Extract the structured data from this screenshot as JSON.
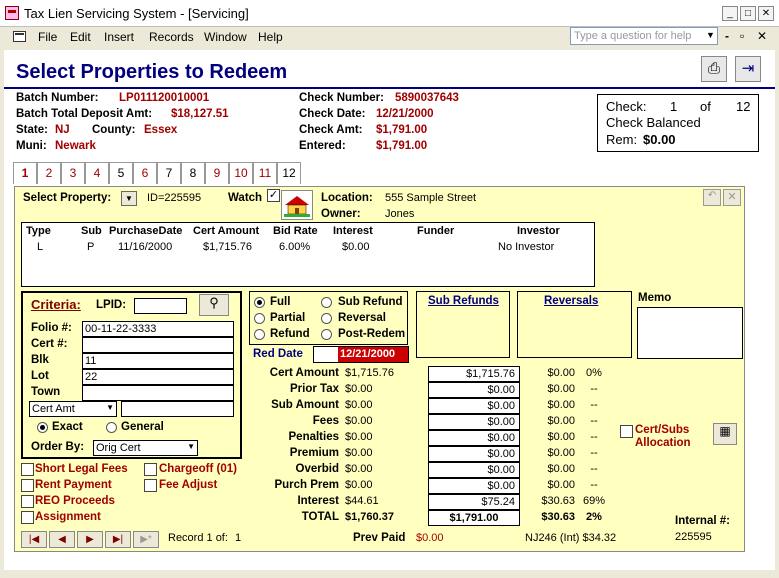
{
  "window": {
    "title": "Tax Lien Servicing System - [Servicing]",
    "minimize": "_",
    "maximize": "□",
    "close": "✕"
  },
  "menu": {
    "items": [
      "File",
      "Edit",
      "Insert",
      "Records",
      "Window",
      "Help"
    ],
    "ask_placeholder": "Type a question for help"
  },
  "heading": "Select Properties to Redeem",
  "header": {
    "batch_number_label": "Batch Number:",
    "batch_number": "LP011120010001",
    "batch_total_label": "Batch Total Deposit Amt:",
    "batch_total": "$18,127.51",
    "state_label": "State:",
    "state": "NJ",
    "county_label": "County:",
    "county": "Essex",
    "muni_label": "Muni:",
    "muni": "Newark",
    "check_number_label": "Check Number:",
    "check_number": "5890037643",
    "check_date_label": "Check Date:",
    "check_date": "12/21/2000",
    "check_amt_label": "Check Amt:",
    "check_amt": "$1,791.00",
    "entered_label": "Entered:",
    "entered": "$1,791.00"
  },
  "check_box": {
    "line1_label": "Check:",
    "current": "1",
    "of": "of",
    "total": "12",
    "balanced": "Check Balanced",
    "rem_label": "Rem:",
    "rem": "$0.00"
  },
  "tabs": [
    "1",
    "2",
    "3",
    "4",
    "5",
    "6",
    "7",
    "8",
    "9",
    "10",
    "11",
    "12"
  ],
  "property": {
    "select_label": "Select Property:",
    "id": "ID=225595",
    "watch_label": "Watch",
    "location_label": "Location:",
    "location": "555 Sample Street",
    "owner_label": "Owner:",
    "owner": "Jones"
  },
  "lien_table": {
    "headers": [
      "Type",
      "Sub",
      "PurchaseDate",
      "Cert Amount",
      "Bid Rate",
      "Interest",
      "Funder",
      "Investor"
    ],
    "row": [
      "L",
      "P",
      "11/16/2000",
      "$1,715.76",
      "6.00%",
      "$0.00",
      "",
      "No Investor"
    ]
  },
  "criteria": {
    "title": "Criteria:",
    "lpid_label": "LPID:",
    "lpid": "",
    "folio_label": "Folio #:",
    "folio": "00-11-22-3333",
    "cert_label": "Cert #:",
    "cert": "",
    "blk_label": "Blk",
    "blk": "11",
    "lot_label": "Lot",
    "lot": "22",
    "town_label": "Town",
    "town": "",
    "amount_type": "Cert Amt",
    "amount_value": "",
    "exact": "Exact",
    "general": "General",
    "order_by_label": "Order By:",
    "order_by": "Orig Cert"
  },
  "redeem_options": {
    "full": "Full",
    "partial": "Partial",
    "refund": "Refund",
    "sub_refund": "Sub Refund",
    "reversal": "Reversal",
    "post_redem": "Post-Redem"
  },
  "links": {
    "sub_refunds": "Sub Refunds",
    "reversals": "Reversals",
    "memo": "Memo"
  },
  "red_date": {
    "label": "Red Date",
    "value": "12/21/2000"
  },
  "amounts": [
    {
      "label": "Cert Amount",
      "orig": "$1,715.76",
      "amt": "$1,715.76",
      "sub": "$0.00",
      "pct": "0%"
    },
    {
      "label": "Prior Tax",
      "orig": "$0.00",
      "amt": "$0.00",
      "sub": "$0.00",
      "pct": "--"
    },
    {
      "label": "Sub Amount",
      "orig": "$0.00",
      "amt": "$0.00",
      "sub": "$0.00",
      "pct": "--"
    },
    {
      "label": "Fees",
      "orig": "$0.00",
      "amt": "$0.00",
      "sub": "$0.00",
      "pct": "--"
    },
    {
      "label": "Penalties",
      "orig": "$0.00",
      "amt": "$0.00",
      "sub": "$0.00",
      "pct": "--"
    },
    {
      "label": "Premium",
      "orig": "$0.00",
      "amt": "$0.00",
      "sub": "$0.00",
      "pct": "--"
    },
    {
      "label": "Overbid",
      "orig": "$0.00",
      "amt": "$0.00",
      "sub": "$0.00",
      "pct": "--"
    },
    {
      "label": "Purch Prem",
      "orig": "$0.00",
      "amt": "$0.00",
      "sub": "$0.00",
      "pct": "--"
    },
    {
      "label": "Interest",
      "orig": "$44.61",
      "amt": "$75.24",
      "sub": "$30.63",
      "pct": "69%"
    }
  ],
  "total": {
    "label": "TOTAL",
    "orig": "$1,760.37",
    "amt": "$1,791.00",
    "sub": "$30.63",
    "pct": "2%"
  },
  "checks": {
    "short_legal": "Short Legal Fees",
    "chargeoff": "Chargeoff (01)",
    "rent": "Rent Payment",
    "fee_adjust": "Fee Adjust",
    "reo": "REO Proceeds",
    "assignment": "Assignment",
    "cert_subs": "Cert/Subs",
    "allocation": "Allocation"
  },
  "watch_checked": true,
  "footer": {
    "record_label": "Record 1 of:",
    "record_total": "1",
    "prev_paid_label": "Prev Paid",
    "prev_paid": "$0.00",
    "nj": "NJ246 (Int) $34.32",
    "internal_label": "Internal #:",
    "internal": "225595"
  }
}
